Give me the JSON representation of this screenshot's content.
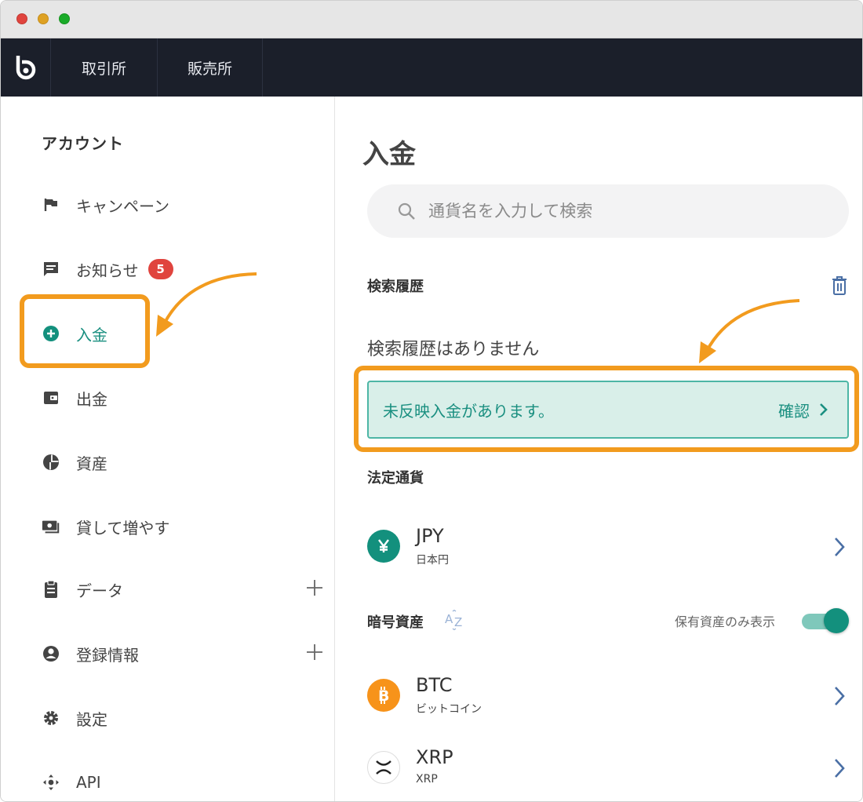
{
  "topnav": {
    "logo_icon": "bitbank-logo-icon",
    "tabs": [
      {
        "label": "取引所"
      },
      {
        "label": "販売所"
      }
    ]
  },
  "sidebar": {
    "title": "アカウント",
    "items": [
      {
        "label": "キャンペーン",
        "icon": "flag-icon"
      },
      {
        "label": "お知らせ",
        "icon": "message-icon",
        "badge": "5"
      },
      {
        "label": "入金",
        "icon": "plus-circle-icon",
        "active": true
      },
      {
        "label": "出金",
        "icon": "wallet-icon"
      },
      {
        "label": "資産",
        "icon": "pie-chart-icon"
      },
      {
        "label": "貸して増やす",
        "icon": "lending-icon"
      },
      {
        "label": "データ",
        "icon": "clipboard-icon",
        "expandable": true
      },
      {
        "label": "登録情報",
        "icon": "account-icon",
        "expandable": true
      },
      {
        "label": "設定",
        "icon": "gear-icon"
      },
      {
        "label": "API",
        "icon": "api-icon"
      }
    ]
  },
  "main": {
    "title": "入金",
    "search": {
      "placeholder": "通貨名を入力して検索"
    },
    "history": {
      "title": "検索履歴",
      "empty": "検索履歴はありません"
    },
    "notice": {
      "message": "未反映入金があります。",
      "action": "確認"
    },
    "fiat": {
      "title": "法定通貨",
      "items": [
        {
          "code": "JPY",
          "name": "日本円",
          "color": "#13907d"
        }
      ]
    },
    "crypto": {
      "title": "暗号資産",
      "toggle_label": "保有資産のみ表示",
      "toggle_on": true,
      "items": [
        {
          "code": "BTC",
          "name": "ビットコイン",
          "color": "#f7931a"
        },
        {
          "code": "XRP",
          "name": "XRP",
          "color": "#222222"
        }
      ]
    }
  },
  "colors": {
    "accent": "#13907d",
    "highlight": "#f29b1e",
    "nav_bg": "#1b1f2a",
    "badge": "#e0443e"
  }
}
